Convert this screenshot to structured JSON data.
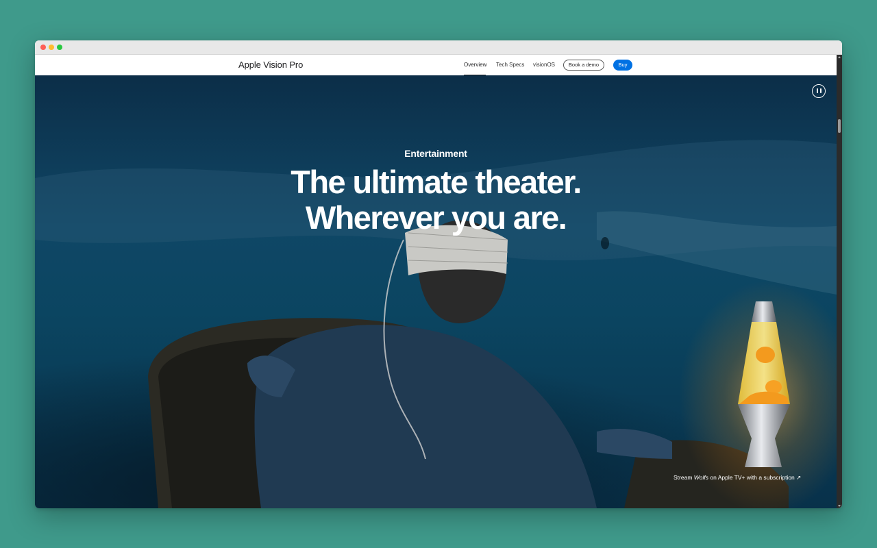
{
  "localnav": {
    "title": "Apple Vision Pro",
    "links": [
      {
        "label": "Overview",
        "active": true
      },
      {
        "label": "Tech Specs"
      },
      {
        "label": "visionOS"
      }
    ],
    "demo_label": "Book a demo",
    "buy_label": "Buy"
  },
  "hero": {
    "eyebrow": "Entertainment",
    "headline_line1": "The ultimate theater.",
    "headline_line2": "Wherever you are.",
    "caption_prefix": "Stream ",
    "caption_title": "Wolfs",
    "caption_suffix": " on Apple TV+ with a subscription ↗"
  },
  "controls": {
    "pause_icon": "pause-icon"
  },
  "colors": {
    "accent": "#0071e3",
    "desktop": "#3f9a8b"
  }
}
